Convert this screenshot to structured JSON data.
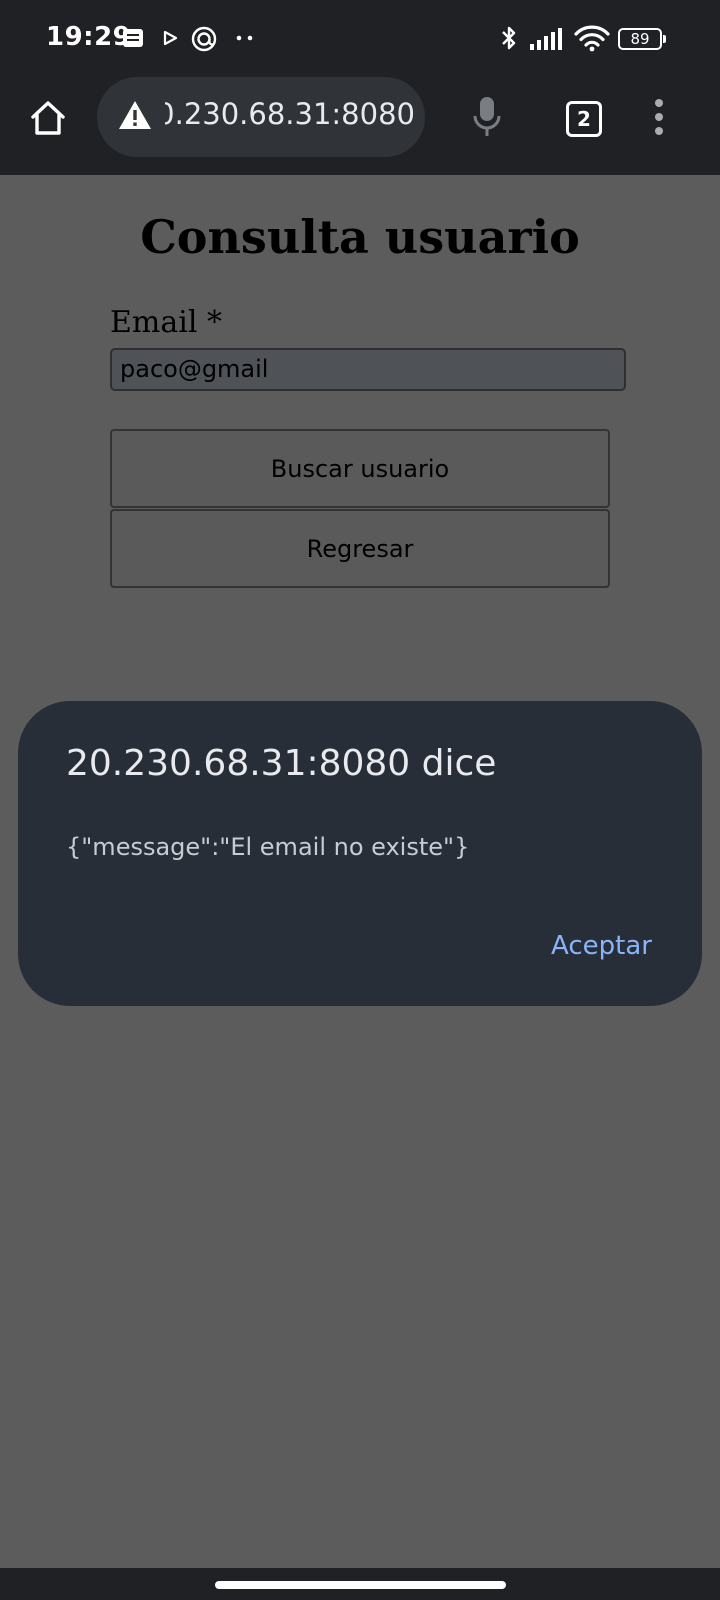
{
  "status_bar": {
    "time": "19:29",
    "battery": "89",
    "icons": [
      "notes-icon",
      "play-icon",
      "at-sign-icon",
      "more-dots-icon",
      "bluetooth-icon",
      "signal-icon",
      "wifi-icon",
      "battery-icon"
    ]
  },
  "browser": {
    "url": "20.230.68.31:8080",
    "tab_count": "2",
    "icons": [
      "home-icon",
      "warning-icon",
      "microphone-icon",
      "tabs-icon",
      "menu-icon"
    ]
  },
  "page": {
    "title": "Consulta usuario",
    "email_label": "Email *",
    "email_value": "paco@gmail",
    "search_button": "Buscar usuario",
    "back_button": "Regresar"
  },
  "dialog": {
    "title": "20.230.68.31:8080 dice",
    "message": "{\"message\":\"El email no existe\"}",
    "ok_label": "Aceptar"
  },
  "colors": {
    "scrim": "#5c5c5c",
    "dialog_bg": "#282e38",
    "accent": "#8ab4f8",
    "chrome_bg": "#202124"
  }
}
